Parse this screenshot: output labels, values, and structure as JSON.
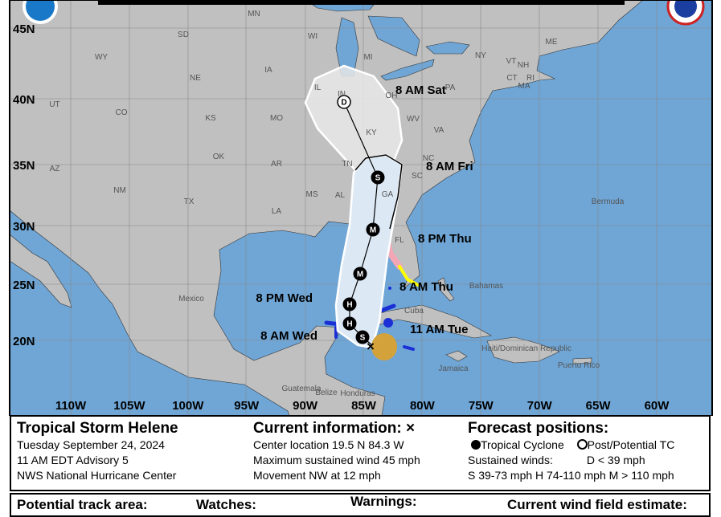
{
  "colors": {
    "ocean": "#6fa6d6",
    "land": "#c0c0c0",
    "hurricane_watch": "#f2a6b6",
    "ts_warning": "#1a2fd6",
    "ts_watch": "#ffff00",
    "wind_field": "#d4a23a",
    "cone": "#dce9f5"
  },
  "lat_labels": [
    "45N",
    "40N",
    "35N",
    "30N",
    "25N",
    "20N"
  ],
  "lon_labels": [
    "110W",
    "105W",
    "100W",
    "95W",
    "90W",
    "85W",
    "80W",
    "75W",
    "70W",
    "65W",
    "60W"
  ],
  "region_labels": [
    "MN",
    "WI",
    "MI",
    "SD",
    "WY",
    "NE",
    "IA",
    "IL",
    "IN",
    "OH",
    "UT",
    "CO",
    "KS",
    "MO",
    "KY",
    "WV",
    "VA",
    "AZ",
    "NM",
    "OK",
    "AR",
    "TN",
    "NC",
    "SC",
    "TX",
    "MS",
    "AL",
    "GA",
    "LA",
    "FL",
    "ME",
    "VT",
    "NH",
    "NY",
    "MA",
    "CT",
    "RI",
    "PA",
    "Bermuda",
    "Bahamas",
    "Mexico",
    "Cuba",
    "Jamaica",
    "Belize",
    "Guatemala",
    "Honduras",
    "Haiti/Dominican Republic",
    "Puerto Rico"
  ],
  "forecast_points": [
    {
      "letter": "S",
      "label": "11 AM Tue"
    },
    {
      "letter": "H",
      "label": "8 AM Wed"
    },
    {
      "letter": "H",
      "label": "8 PM Wed"
    },
    {
      "letter": "M",
      "label": "8 AM Thu"
    },
    {
      "letter": "M",
      "label": "8 PM Thu"
    },
    {
      "letter": "S",
      "label": "8 AM Fri"
    },
    {
      "letter": "D",
      "label": "8 AM Sat"
    }
  ],
  "info": {
    "storm_name": "Tropical Storm Helene",
    "date": "Tuesday September 24, 2024",
    "advisory": "11 AM EDT Advisory 5",
    "agency": "NWS National Hurricane Center",
    "current_title": "Current information: ×",
    "center": "Center location 19.5 N 84.3 W",
    "max_wind": "Maximum sustained wind 45 mph",
    "movement": "Movement NW at 12 mph",
    "forecast_title": "Forecast positions:",
    "tc_label": "Tropical Cyclone",
    "post_tc_label": "Post/Potential TC",
    "sustained": "Sustained winds:",
    "d_def": "D < 39 mph",
    "shm_def": "S 39-73 mph  H 74-110 mph  M > 110 mph"
  },
  "legend2": {
    "track_area": "Potential track area:",
    "watches": "Watches:",
    "warnings": "Warnings:",
    "wind_field": "Current wind field estimate:"
  }
}
